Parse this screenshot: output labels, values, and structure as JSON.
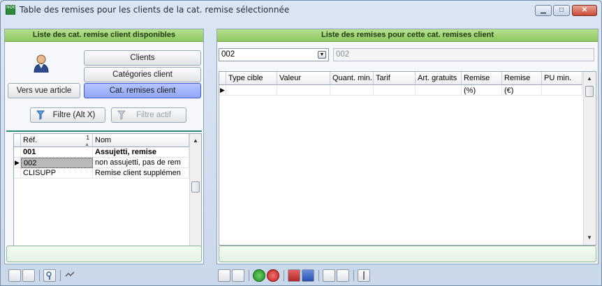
{
  "window": {
    "title": "Table des remises pour les clients de la cat. remise sélectionnée",
    "icon_label": "NOE",
    "controls": [
      "minimize-icon",
      "maximize-icon",
      "close-icon"
    ]
  },
  "left": {
    "header": "Liste des cat. remise client disponibles",
    "buttons": {
      "clients": "Clients",
      "categories": "Catégories client",
      "cat_remises": "Cat. remises client",
      "vers_vue": "Vers vue article",
      "filtre": "Filtre (Alt X)",
      "filtre_actif": "Filtre actif"
    },
    "grid": {
      "columns": [
        "Réf.",
        "Nom"
      ],
      "sort_indicator": "1",
      "rows": [
        {
          "ref": "001",
          "nom": "Assujetti, remise"
        },
        {
          "ref": "002",
          "nom": "non assujetti, pas de rem"
        },
        {
          "ref": "CLISUPP",
          "nom": "Remise client supplémen"
        }
      ],
      "current_row": 1
    }
  },
  "right": {
    "header": "Liste des remises pour cette cat. remises client",
    "combo_value": "002",
    "combo_label": "002",
    "grid": {
      "columns": [
        "Type cible",
        "Valeur",
        "Quant. min.",
        "Tarif",
        "Art. gratuits",
        "Remise (%)",
        "Remise (€)",
        "PU min."
      ]
    }
  },
  "colors": {
    "header_green": "#8fc860",
    "selected_blue": "#8fa5f7",
    "title_bar": "#dbe6f4"
  }
}
